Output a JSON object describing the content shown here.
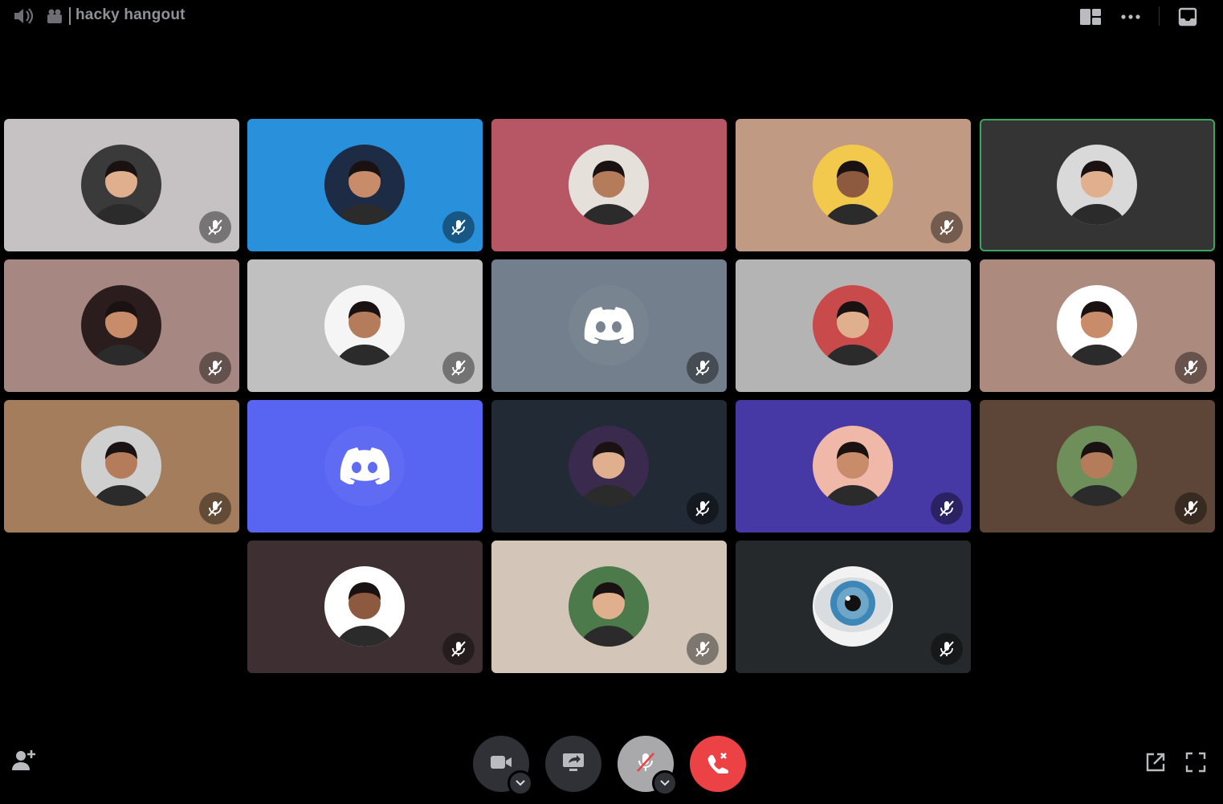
{
  "channel": {
    "name": "hacky hangout"
  },
  "icons": {
    "speaker": "speaker-icon",
    "camera_small": "camera-icon",
    "layout": "grid-layout-icon",
    "more": "more-icon",
    "inbox": "inbox-icon",
    "mic_muted": "mic-muted-icon",
    "discord": "discord-logo-icon",
    "invite": "add-friend-icon",
    "popout": "popout-icon",
    "fullscreen": "fullscreen-icon"
  },
  "colors": {
    "speaking_ring": "#3ba55d",
    "disconnect": "#ed4245",
    "blurple": "#5865f2"
  },
  "participants": [
    {
      "bg": "#c6c2c4",
      "muted": true,
      "avatar": "photo",
      "speaking": false
    },
    {
      "bg": "#2991dc",
      "muted": true,
      "avatar": "photo",
      "speaking": false
    },
    {
      "bg": "#b75766",
      "muted": false,
      "avatar": "photo",
      "speaking": false
    },
    {
      "bg": "#c09a82",
      "muted": true,
      "avatar": "photo",
      "speaking": false
    },
    {
      "bg": "#343434",
      "muted": false,
      "avatar": "photo",
      "speaking": true
    },
    {
      "bg": "#a68781",
      "muted": true,
      "avatar": "photo",
      "speaking": false
    },
    {
      "bg": "#c0c0c0",
      "muted": true,
      "avatar": "photo",
      "speaking": false
    },
    {
      "bg": "#747f8d",
      "muted": true,
      "avatar": "discord",
      "speaking": false
    },
    {
      "bg": "#b5b4b5",
      "muted": false,
      "avatar": "photo",
      "speaking": false
    },
    {
      "bg": "#ac8a7e",
      "muted": true,
      "avatar": "photo",
      "speaking": false
    },
    {
      "bg": "#a47d5c",
      "muted": true,
      "avatar": "photo",
      "speaking": false
    },
    {
      "bg": "#5865f2",
      "muted": false,
      "avatar": "discord",
      "speaking": false
    },
    {
      "bg": "#222a35",
      "muted": true,
      "avatar": "photo",
      "speaking": false
    },
    {
      "bg": "#4639a5",
      "muted": true,
      "avatar": "photo",
      "speaking": false
    },
    {
      "bg": "#5d4637",
      "muted": true,
      "avatar": "photo",
      "speaking": false
    },
    {
      "bg": "#3e2f33",
      "muted": true,
      "avatar": "photo",
      "speaking": false
    },
    {
      "bg": "#d3c6b9",
      "muted": true,
      "avatar": "photo",
      "speaking": false
    },
    {
      "bg": "#26292b",
      "muted": true,
      "avatar": "photo",
      "speaking": false
    }
  ],
  "controls": {
    "camera": "camera-icon",
    "screen_share": "screen-share-icon",
    "mute": "mic-muted-icon",
    "disconnect": "phone-disconnect-icon"
  }
}
